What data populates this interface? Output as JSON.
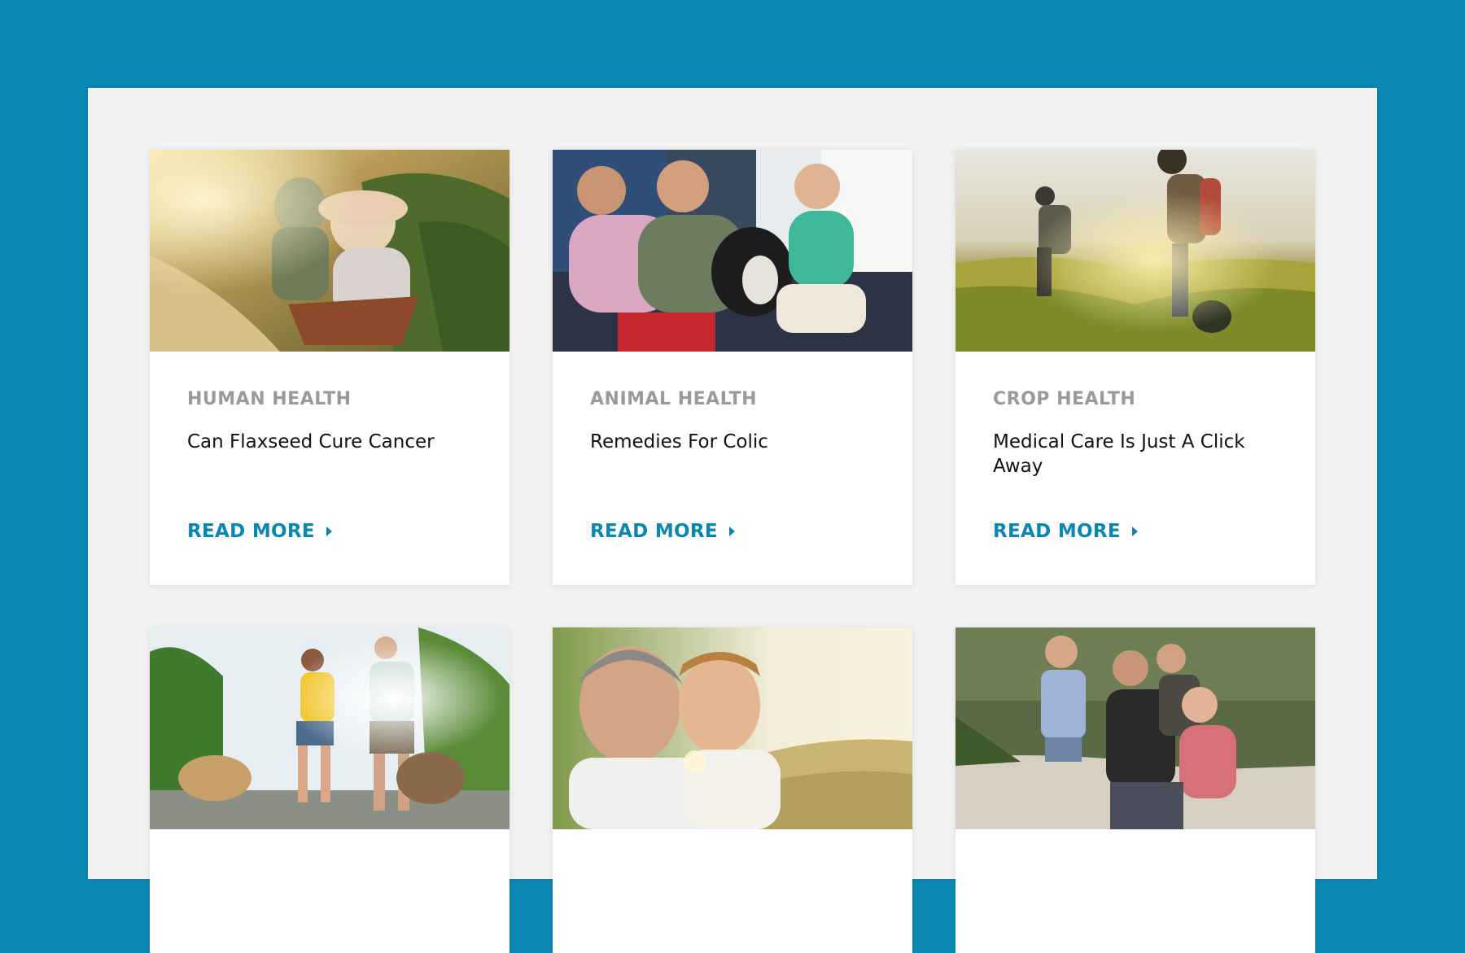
{
  "colors": {
    "background": "#0b89b3",
    "panel": "#f2f2f2",
    "accent": "#0a86b2",
    "category_text": "#9a9a9a"
  },
  "cards": [
    {
      "category": "HUMAN HEALTH",
      "title": "Can Flaxseed Cure Cancer",
      "cta": "READ MORE",
      "image": "children-gardening-wheelbarrow-photo"
    },
    {
      "category": "ANIMAL HEALTH",
      "title": "Remedies For Colic",
      "cta": "READ MORE",
      "image": "family-with-dog-on-couch-photo"
    },
    {
      "category": "CROP HEALTH",
      "title": "Medical Care Is Just A Click Away",
      "cta": "READ MORE",
      "image": "farmers-in-pumpkin-field-photo"
    },
    {
      "image": "couple-walking-dogs-photo"
    },
    {
      "image": "grandfather-and-grandson-photo"
    },
    {
      "image": "family-portrait-country-road-photo"
    }
  ]
}
